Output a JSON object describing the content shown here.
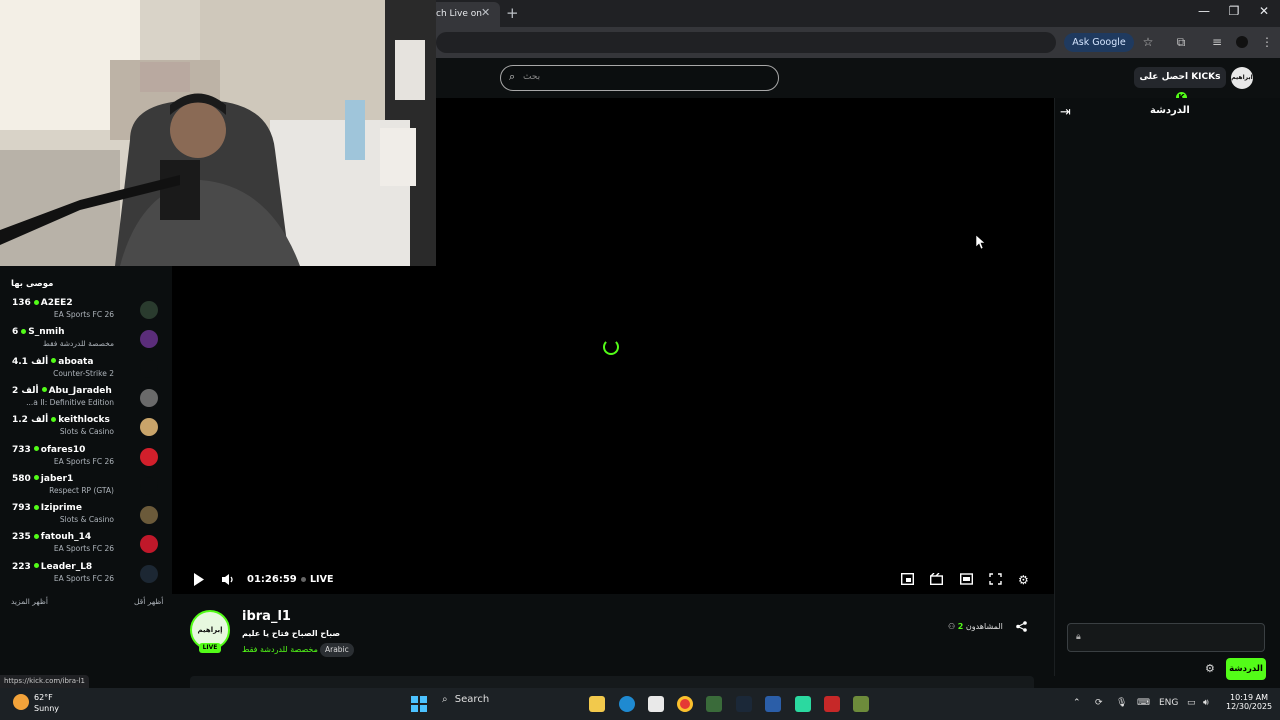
{
  "browser": {
    "tab_title": "ch Live on",
    "tab_close": "✕",
    "new_tab": "+",
    "ask_google": "Ask Google",
    "window_controls": {
      "minimize": "—",
      "restore": "❐",
      "close": "✕"
    }
  },
  "header": {
    "search_placeholder": "بحث",
    "get_kicks_label": "احصل على KICKs",
    "user_avatar_text": "ابراهيم"
  },
  "sidebar": {
    "title": "موصى بها",
    "channels": [
      {
        "viewers": "136",
        "name": "A2EE2",
        "game": "EA Sports FC 26",
        "avatar_color": "#2a3b2e"
      },
      {
        "viewers": "6",
        "name": "S_nmih",
        "game": "مخصصة للدردشة فقط",
        "avatar_color": "#5b2d7a"
      },
      {
        "viewers": "4.1 ألف",
        "name": "aboata",
        "game": "Counter-Strike 2",
        "avatar_color": "#0b0e0f"
      },
      {
        "viewers": "2 ألف",
        "name": "Abu_Jaradeh",
        "game": "...a II: Definitive Edition",
        "avatar_color": "#6a6a6a"
      },
      {
        "viewers": "1.2 ألف",
        "name": "keithlocks",
        "game": "Slots & Casino",
        "avatar_color": "#c9a46a"
      },
      {
        "viewers": "733",
        "name": "ofares10",
        "game": "EA Sports FC 26",
        "avatar_color": "#d21f2b"
      },
      {
        "viewers": "580",
        "name": "jaber1",
        "game": "Respect RP (GTA)",
        "avatar_color": "#0b0e0f"
      },
      {
        "viewers": "793",
        "name": "Iziprime",
        "game": "Slots & Casino",
        "avatar_color": "#6b5a3a"
      },
      {
        "viewers": "235",
        "name": "fatouh_14",
        "game": "EA Sports FC 26",
        "avatar_color": "#c0182a"
      },
      {
        "viewers": "223",
        "name": "Leader_L8",
        "game": "EA Sports FC 26",
        "avatar_color": "#1c2733"
      }
    ],
    "show_more": "أظهر المزيد",
    "show_less": "أظهر أقل"
  },
  "player": {
    "timecode": "01:26:59",
    "live_label": "LIVE"
  },
  "chat": {
    "title": "الدردشة",
    "send_label": "الدردشة"
  },
  "stream": {
    "streamer_name": "ibra_l1",
    "avatar_text": "إبراهيم",
    "live_badge": "LIVE",
    "title": "صباح الصباح فتاح يا عليم",
    "category": "مخصصة للدردشة فقط",
    "tag": "Arabic",
    "viewers_label": "المشاهدون",
    "viewers_count": "2"
  },
  "status_url": "https://kick.com/ibra-l1",
  "taskbar": {
    "temperature": "62°F",
    "weather": "Sunny",
    "search_label": "Search",
    "language": "ENG",
    "time": "10:19 AM",
    "date": "12/30/2025"
  }
}
